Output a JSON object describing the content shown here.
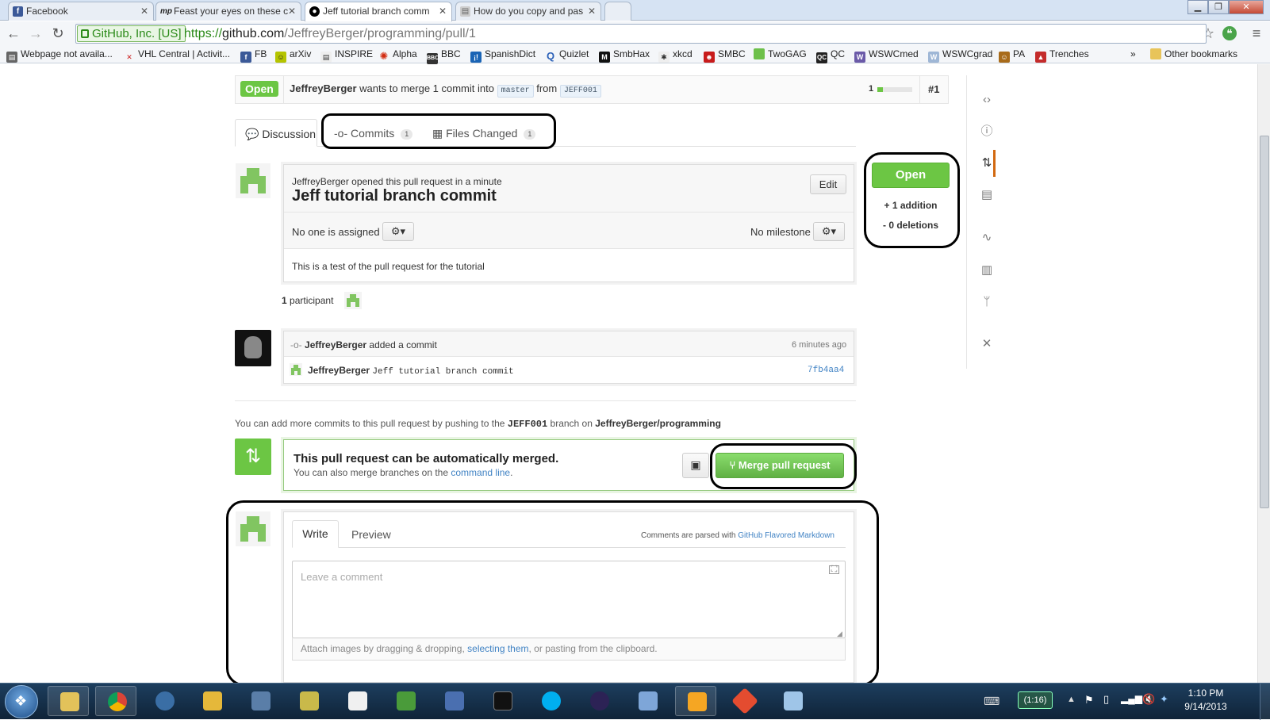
{
  "browser": {
    "tabs": [
      {
        "label": "Facebook",
        "icon": "facebook-icon",
        "color": "#3b5998"
      },
      {
        "label": "Feast your eyes on these c",
        "icon": "mp-icon",
        "color": "#222222"
      },
      {
        "label": "Jeff tutorial branch comm",
        "icon": "github-icon",
        "color": "#000000",
        "active": true
      },
      {
        "label": "How do you copy and pas",
        "icon": "page-icon",
        "color": "#888888"
      }
    ],
    "ev_label": "GitHub, Inc. [US]",
    "url_scheme": "https://",
    "url_host": "github.com",
    "url_path": "/JeffreyBerger/programming/pull/1",
    "bookmarks": [
      {
        "label": "Webpage not availa...",
        "color": "#666666"
      },
      {
        "label": "VHL Central | Activit...",
        "color": "#cc2222"
      },
      {
        "label": "FB",
        "color": "#3b5998"
      },
      {
        "label": "arXiv",
        "color": "#b5c400"
      },
      {
        "label": "INSPIRE",
        "color": "#ffffff"
      },
      {
        "label": "Alpha",
        "color": "#d22b10"
      },
      {
        "label": "BBC",
        "color": "#333333"
      },
      {
        "label": "SpanishDict",
        "color": "#1a64b5"
      },
      {
        "label": "Quizlet",
        "color": "#2b61b8"
      },
      {
        "label": "SmbHax",
        "color": "#111111"
      },
      {
        "label": "xkcd",
        "color": "#777777"
      },
      {
        "label": "SMBC",
        "color": "#c81b1b"
      },
      {
        "label": "TwoGAG",
        "color": "#6dc04a"
      },
      {
        "label": "QC",
        "color": "#222222"
      },
      {
        "label": "WSWCmed",
        "color": "#6b5aa8"
      },
      {
        "label": "WSWCgrad",
        "color": "#9fb7d6"
      },
      {
        "label": "PA",
        "color": "#a86b1a"
      },
      {
        "label": "Trenches",
        "color": "#c42b2b"
      }
    ],
    "bookmarks_overflow": "»",
    "other_bookmarks": "Other bookmarks"
  },
  "pr": {
    "state_badge": "Open",
    "author": "JeffreyBerger",
    "merge_text": "wants to merge 1 commit into",
    "base_branch": "master",
    "from_text": "from",
    "head_branch": "JEFF001",
    "comment_count": "1",
    "number": "#1",
    "tabs": {
      "discussion": "Discussion",
      "commits": "Commits",
      "commits_count": "1",
      "files": "Files Changed",
      "files_count": "1"
    },
    "opened_by": "JeffreyBerger",
    "opened_text": "opened this pull request in a minute",
    "title": "Jeff tutorial branch commit",
    "edit_label": "Edit",
    "assignee": "No one is assigned",
    "milestone": "No milestone",
    "body": "This is a test of the pull request for the tutorial",
    "participants_count": "1",
    "participants_label": "participant",
    "side_state": "Open",
    "additions": "+ 1 addition",
    "deletions": "- 0 deletions",
    "commit_event_author": "JeffreyBerger",
    "commit_event_text": "added a commit",
    "commit_event_time": "6 minutes ago",
    "commit_author": "JeffreyBerger",
    "commit_message": "Jeff tutorial branch commit",
    "commit_sha": "7fb4aa4",
    "push_hint_a": "You can add more commits to this pull request by pushing to the",
    "push_hint_branch": "JEFF001",
    "push_hint_b": "branch on",
    "push_hint_repo": "JeffreyBerger/programming",
    "merge_title": "This pull request can be automatically merged.",
    "merge_sub_a": "You can also merge branches on the",
    "merge_sub_link": "command line",
    "merge_sub_end": ".",
    "merge_button": "Merge pull request",
    "write_tab": "Write",
    "preview_tab": "Preview",
    "markdown_hint": "Comments are parsed with",
    "markdown_link": "GitHub Flavored Markdown",
    "comment_placeholder": "Leave a comment",
    "attach_a": "Attach images by dragging & dropping,",
    "attach_link": "selecting them",
    "attach_b": ", or pasting from the clipboard."
  },
  "taskbar": {
    "battery": "(1:16)",
    "time": "1:10 PM",
    "date": "9/14/2013"
  },
  "colors": {
    "github_green": "#6cc644",
    "link_blue": "#4183c4",
    "taskbar": "#15304c"
  }
}
